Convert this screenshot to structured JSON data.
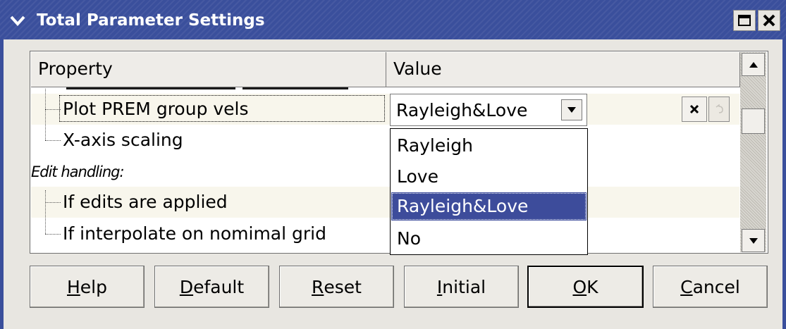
{
  "window": {
    "title": "Total Parameter Settings"
  },
  "table": {
    "columns": [
      "Property",
      "Value"
    ],
    "rows": [
      {
        "label": "Plot PREM group vels",
        "style": "tree-child"
      },
      {
        "label": "X-axis scaling",
        "style": "tree-child-last"
      },
      {
        "label": "Edit handling:",
        "style": "section-heading"
      },
      {
        "label": "If edits are applied",
        "style": "tree-child"
      },
      {
        "label": "If interpolate on nomimal grid",
        "style": "tree-child-last"
      }
    ]
  },
  "combo": {
    "value": "Rayleigh&Love",
    "options": [
      "Rayleigh",
      "Love",
      "Rayleigh&Love",
      "No"
    ],
    "selected": "Rayleigh&Love"
  },
  "buttons": {
    "help": {
      "mnemonic": "H",
      "rest": "elp"
    },
    "default": {
      "mnemonic": "D",
      "rest": "efault"
    },
    "reset": {
      "mnemonic": "R",
      "rest": "eset"
    },
    "initial": {
      "mnemonic": "I",
      "rest": "nitial"
    },
    "ok": {
      "mnemonic": "O",
      "rest": "K"
    },
    "cancel": {
      "mnemonic": "C",
      "rest": "ancel"
    }
  },
  "icons": {
    "title_menu": "chevron-down-icon",
    "maximize": "maximize-icon",
    "close": "close-icon",
    "clear_value": "clear-x-icon",
    "apply_value": "undo-arrow-icon",
    "scroll_up": "scroll-up-arrow-icon",
    "scroll_down": "scroll-down-arrow-icon",
    "combo_arrow": "combo-arrow-icon"
  },
  "colors": {
    "titlebar": "#3a4f9c",
    "selection": "#3d4c9b",
    "row_cream": "#f8f6ec",
    "window_bg": "#e8e6e1"
  }
}
